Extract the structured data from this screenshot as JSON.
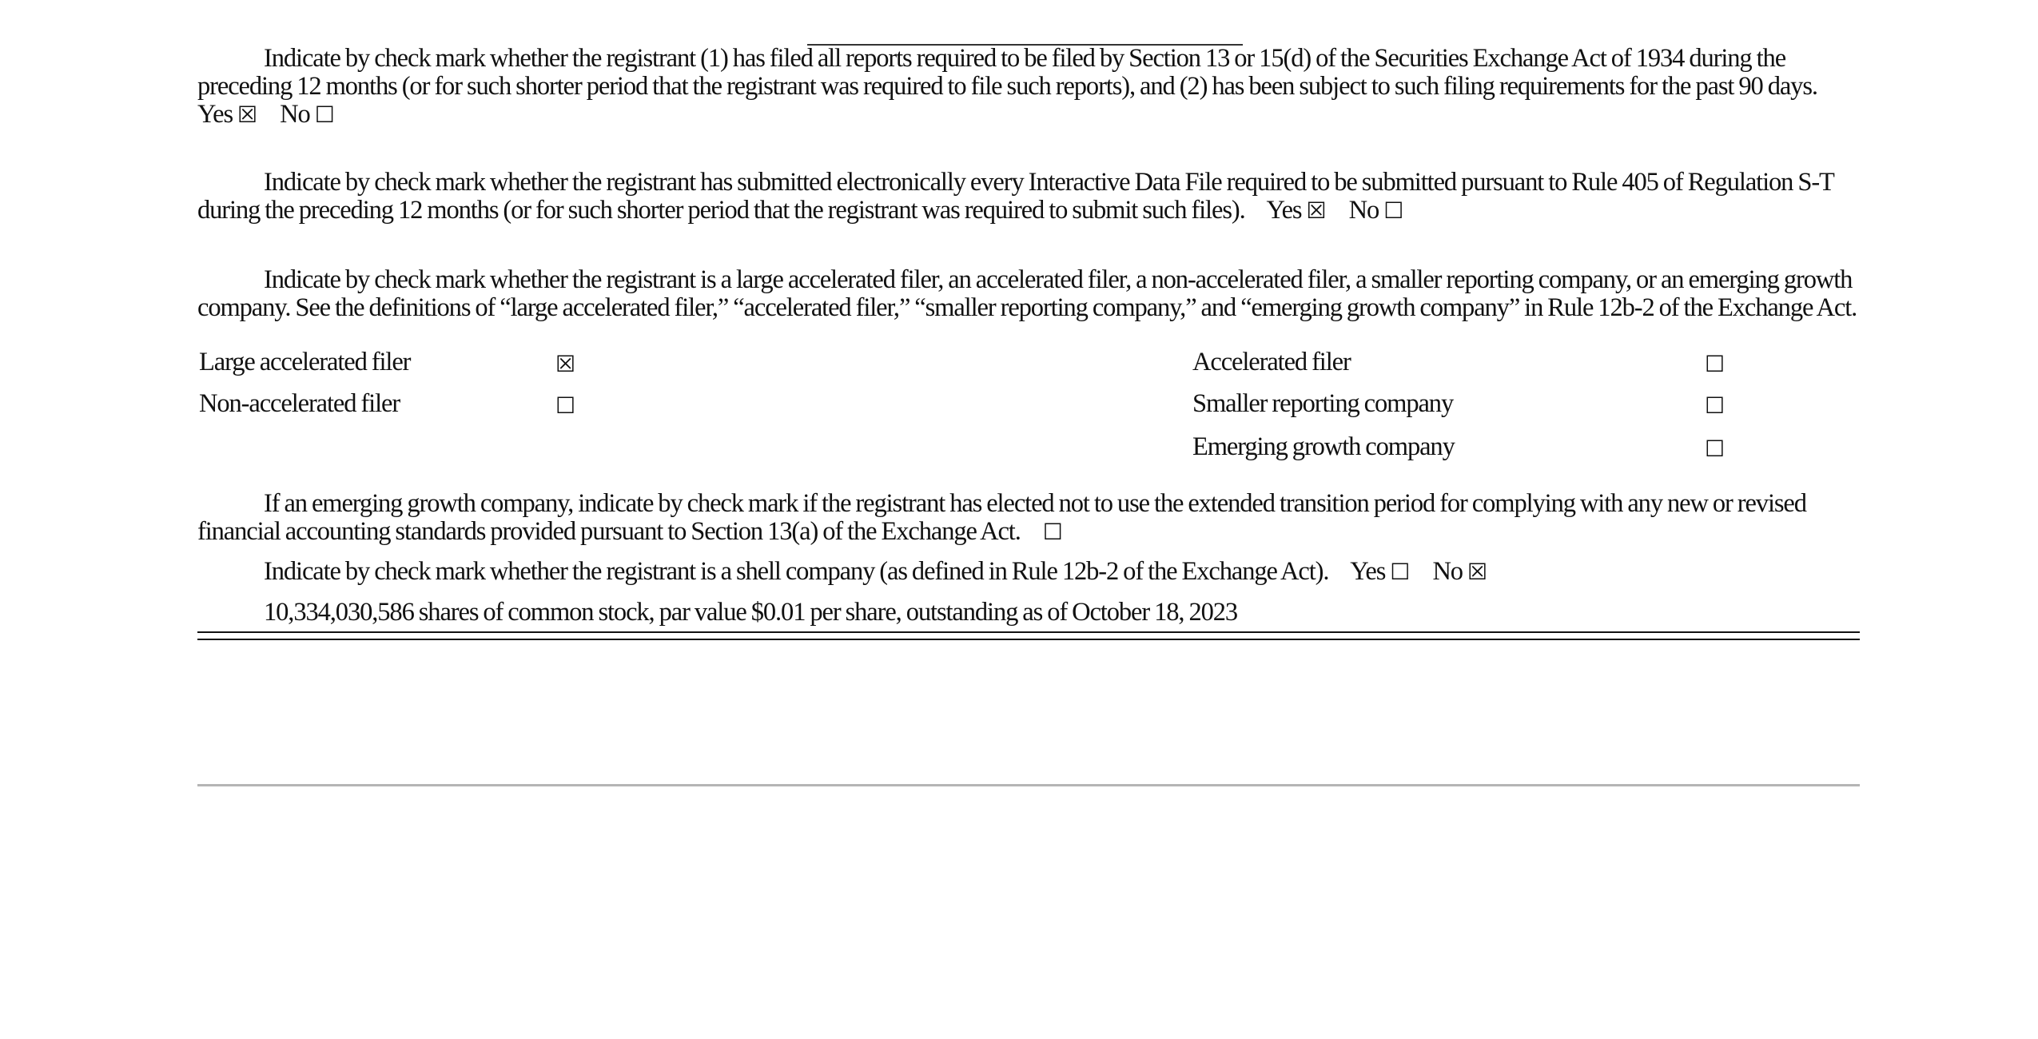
{
  "reporting_paragraph": {
    "text": "Indicate by check mark whether the registrant (1) has filed all reports required to be filed by Section 13 or 15(d) of the Securities Exchange Act of 1934 during the preceding 12 months (or for such shorter period that the registrant was required to file such reports), and (2) has been subject to such filing requirements for the past 90 days.",
    "yes_label": "Yes",
    "yes_box": "☒",
    "no_label": "No",
    "no_box": "☐"
  },
  "interactive_data_paragraph": {
    "text": "Indicate by check mark whether the registrant has submitted electronically every Interactive Data File required to be submitted pursuant to Rule 405 of Regulation S-T during the preceding 12 months (or for such shorter period that the registrant was required to submit such files).",
    "yes_label": "Yes",
    "yes_box": "☒",
    "no_label": "No",
    "no_box": "☐"
  },
  "filer_status_paragraph": {
    "text": "Indicate by check mark whether the registrant is a large accelerated filer, an accelerated filer, a non-accelerated filer, a smaller reporting company, or an emerging growth company. See the definitions of “large accelerated filer,” “accelerated filer,” “smaller reporting company,” and “emerging growth company” in Rule 12b-2 of the Exchange Act."
  },
  "filer_options": {
    "large_accelerated": {
      "label": "Large accelerated filer",
      "box": "☒"
    },
    "accelerated": {
      "label": "Accelerated filer",
      "box": "☐"
    },
    "non_accelerated": {
      "label": "Non-accelerated filer",
      "box": "☐"
    },
    "smaller_reporting": {
      "label": "Smaller reporting company",
      "box": "☐"
    },
    "emerging_growth": {
      "label": "Emerging growth company",
      "box": "☐"
    }
  },
  "transition_paragraph": {
    "text": "If an emerging growth company, indicate by check mark if the registrant has elected not to use the extended transition period for complying with any new or revised financial accounting standards provided pursuant to Section 13(a) of the Exchange Act.",
    "box": "☐"
  },
  "shell_paragraph": {
    "text": "Indicate by check mark whether the registrant is a shell company (as defined in Rule 12b-2 of the Exchange Act).",
    "yes_label": "Yes",
    "yes_box": "☐",
    "no_label": "No",
    "no_box": "☒"
  },
  "shares_outstanding": {
    "text": "10,334,030,586 shares of common stock, par value $0.01 per share, outstanding as of October 18, 2023"
  }
}
